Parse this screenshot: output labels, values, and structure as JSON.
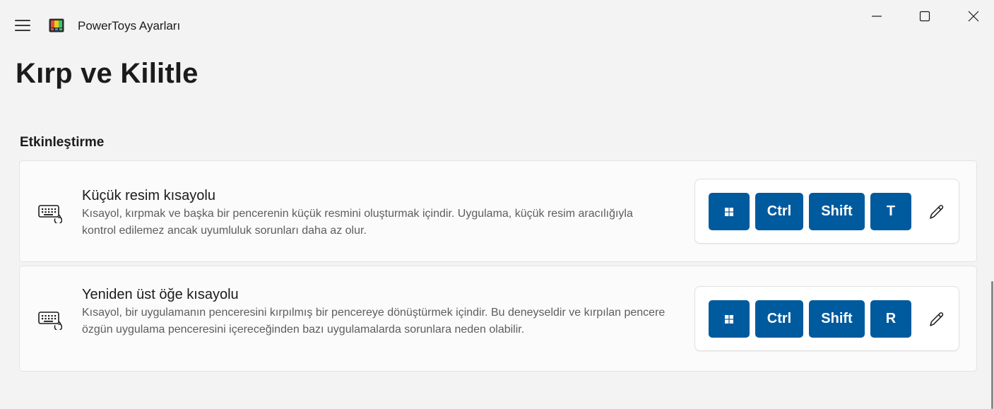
{
  "app": {
    "title": "PowerToys Ayarları",
    "icon": "powertoys-logo"
  },
  "window_controls": {
    "minimize": "minimize-icon",
    "maximize": "maximize-icon",
    "close": "close-icon"
  },
  "page": {
    "title": "Kırp ve Kilitle"
  },
  "section": {
    "title": "Etkinleştirme"
  },
  "shortcuts": [
    {
      "heading": "Küçük resim kısayolu",
      "description": "Kısayol, kırpmak ve başka bir pencerenin küçük resmini oluşturmak içindir. Uygulama, küçük resim aracılığıyla kontrol edilemez ancak uyumluluk sorunları daha az olur.",
      "icon": "keyboard-shortcut-icon",
      "keys": [
        "win",
        "Ctrl",
        "Shift",
        "T"
      ]
    },
    {
      "heading": "Yeniden üst öğe kısayolu",
      "description": "Kısayol, bir uygulamanın penceresini kırpılmış bir pencereye dönüştürmek içindir. Bu deneyseldir ve kırpılan pencere özgün uygulama penceresini içereceğinden bazı uygulamalarda sorunlara neden olabilir.",
      "icon": "keyboard-shortcut-icon",
      "keys": [
        "win",
        "Ctrl",
        "Shift",
        "R"
      ]
    }
  ],
  "colors": {
    "background": "#f3f3f3",
    "card": "#fbfbfb",
    "key_accent": "#005a9e",
    "text": "#1b1b1b",
    "secondary_text": "#5d5d5d"
  }
}
